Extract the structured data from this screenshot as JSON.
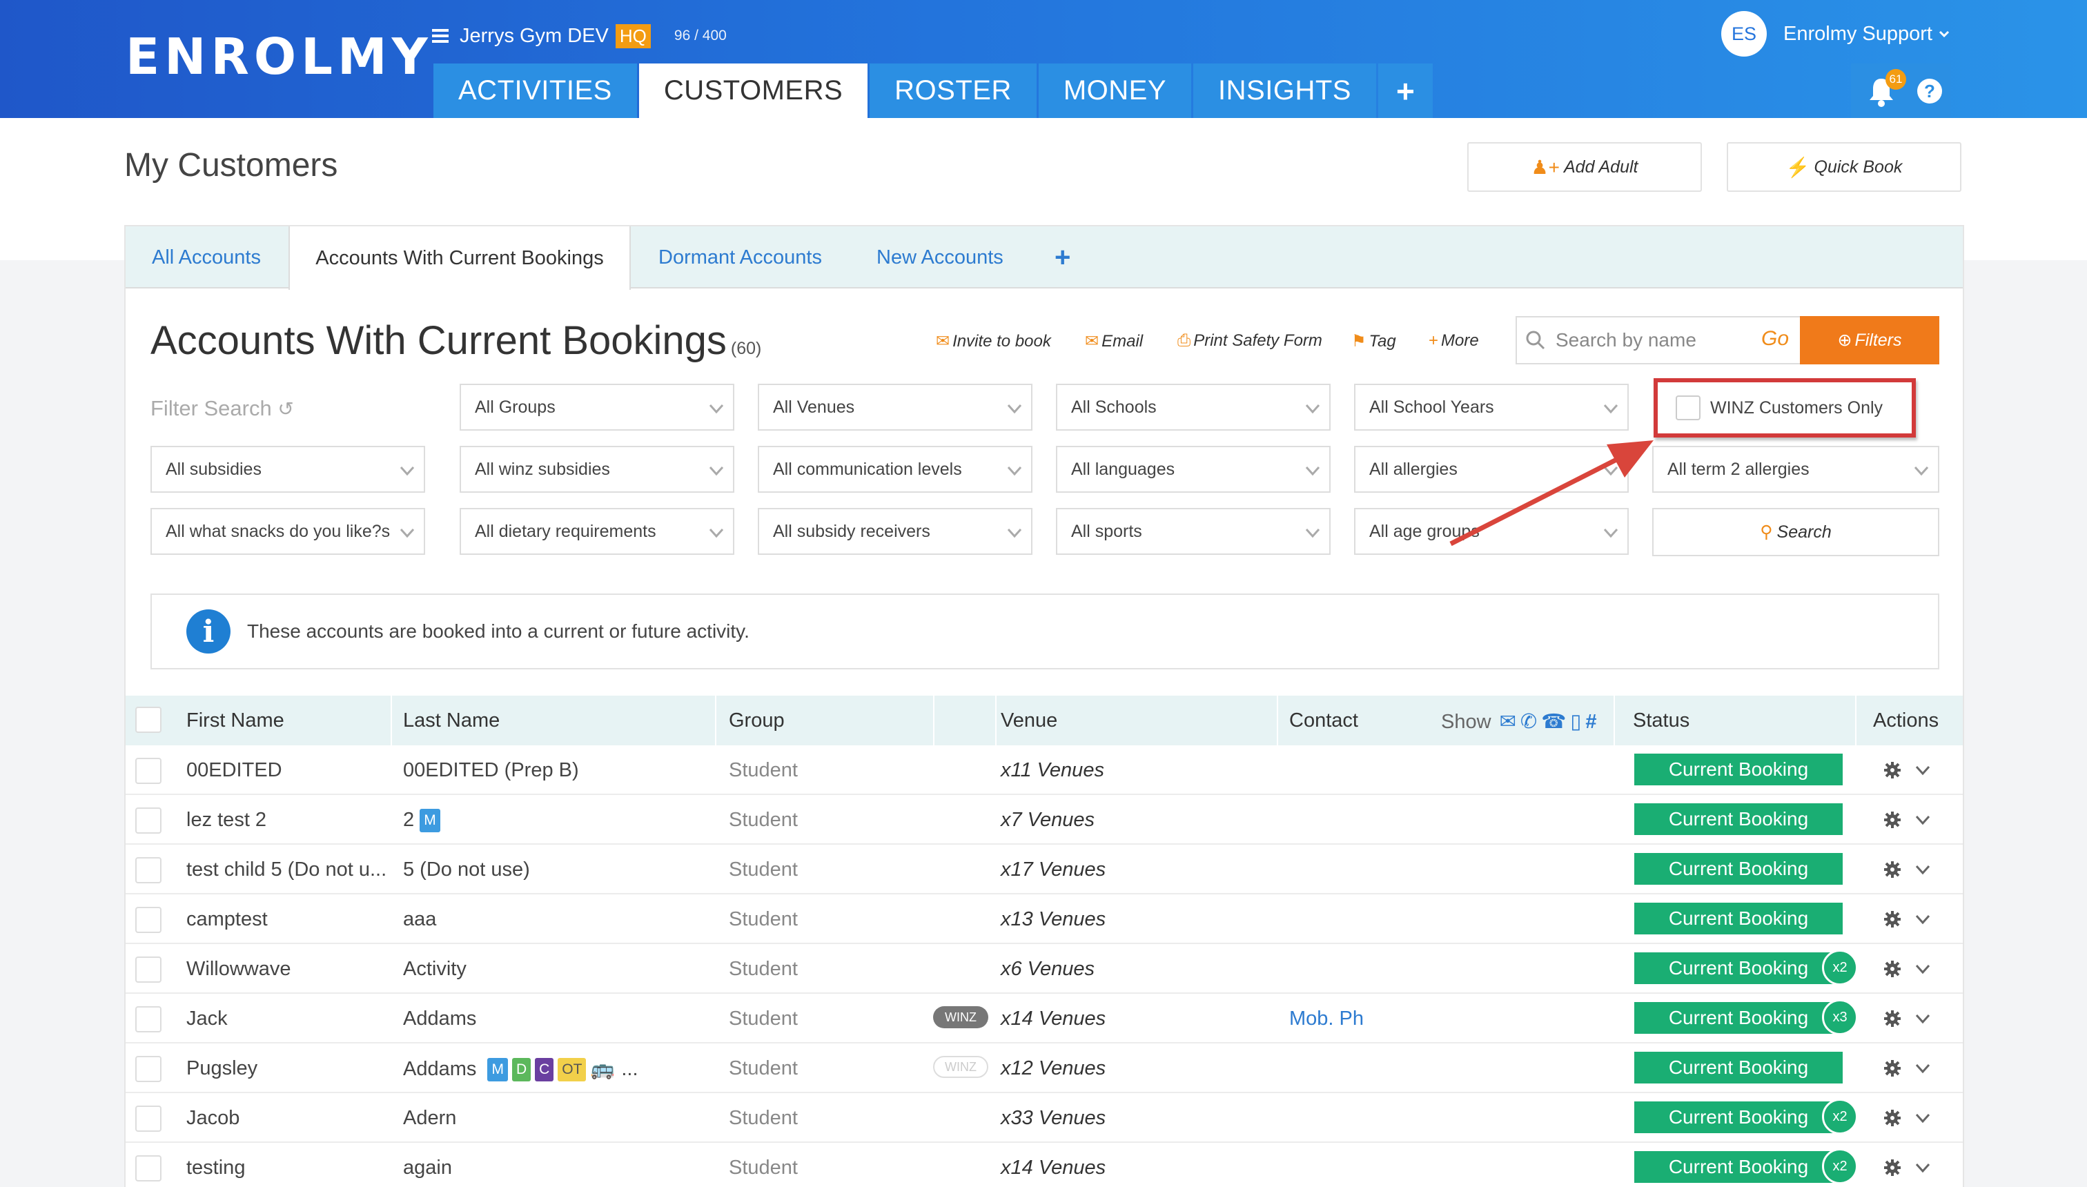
{
  "app": {
    "logo": "ENROLMY",
    "gym_name": "Jerrys Gym DEV",
    "hq_badge": "HQ",
    "usage": "96 / 400"
  },
  "nav": {
    "tabs": [
      "ACTIVITIES",
      "CUSTOMERS",
      "ROSTER",
      "MONEY",
      "INSIGHTS"
    ],
    "active": "CUSTOMERS",
    "plus": "+"
  },
  "user": {
    "initials": "ES",
    "name": "Enrolmy Support",
    "notifications": "61",
    "help": "?"
  },
  "page": {
    "title": "My Customers",
    "add_adult": "Add Adult",
    "quick_book": "Quick Book"
  },
  "subtabs": [
    "All Accounts",
    "Accounts With Current Bookings",
    "Dormant Accounts",
    "New Accounts"
  ],
  "section": {
    "title": "Accounts With Current Bookings",
    "count": "(60)"
  },
  "actions": {
    "invite": "Invite to book",
    "email": "Email",
    "print": "Print Safety Form",
    "tag": "Tag",
    "more": "More"
  },
  "search": {
    "placeholder": "Search by name",
    "go": "Go",
    "filters": "Filters",
    "search_btn": "Search"
  },
  "filters": {
    "label": "Filter Search",
    "row1": [
      "All Groups",
      "All Venues",
      "All Schools",
      "All School Years"
    ],
    "winz": "WINZ Customers Only",
    "row2": [
      "All subsidies",
      "All winz subsidies",
      "All communication levels",
      "All languages",
      "All allergies",
      "All term 2 allergies"
    ],
    "row3": [
      "All what snacks do you like?s",
      "All dietary requirements",
      "All subsidy receivers",
      "All sports",
      "All age groups"
    ]
  },
  "info": "These accounts are booked into a current or future activity.",
  "table": {
    "headers": {
      "first": "First Name",
      "last": "Last Name",
      "group": "Group",
      "venue": "Venue",
      "contact": "Contact",
      "show": "Show",
      "status": "Status",
      "actions": "Actions"
    },
    "rows": [
      {
        "first": "00EDITED",
        "last": "00EDITED (Prep B)",
        "group": "Student",
        "venue": "x11 Venues",
        "contact": "",
        "status": "Current Booking",
        "extra": ""
      },
      {
        "first": "lez test 2",
        "last": "2",
        "group": "Student",
        "venue": "x7 Venues",
        "contact": "",
        "status": "Current Booking",
        "extra": ""
      },
      {
        "first": "test child 5 (Do not u...",
        "last": "5 (Do not use)",
        "group": "Student",
        "venue": "x17 Venues",
        "contact": "",
        "status": "Current Booking",
        "extra": ""
      },
      {
        "first": "camptest",
        "last": "aaa",
        "group": "Student",
        "venue": "x13 Venues",
        "contact": "",
        "status": "Current Booking",
        "extra": ""
      },
      {
        "first": "Willowwave",
        "last": "Activity",
        "group": "Student",
        "venue": "x6 Venues",
        "contact": "",
        "status": "Current Booking",
        "extra": "x2"
      },
      {
        "first": "Jack",
        "last": "Addams",
        "group": "Student",
        "venue": "x14 Venues",
        "contact": "Mob. Ph",
        "status": "Current Booking",
        "extra": "x3"
      },
      {
        "first": "Pugsley",
        "last": "Addams",
        "group": "Student",
        "venue": "x12 Venues",
        "contact": "",
        "status": "Current Booking",
        "extra": ""
      },
      {
        "first": "Jacob",
        "last": "Adern",
        "group": "Student",
        "venue": "x33 Venues",
        "contact": "",
        "status": "Current Booking",
        "extra": "x2"
      },
      {
        "first": "testing",
        "last": "again",
        "group": "Student",
        "venue": "x14 Venues",
        "contact": "",
        "status": "Current Booking",
        "extra": "x2"
      }
    ],
    "row1_tag": "M",
    "pugsley_tags": [
      "M",
      "D",
      "C",
      "OT"
    ],
    "pugsley_more": "...",
    "winz_label": "WINZ"
  },
  "colors": {
    "accent": "#f08c1a",
    "status_green": "#1aae73",
    "nav_blue": "#2374dc",
    "highlight_red": "#d23a3a"
  }
}
